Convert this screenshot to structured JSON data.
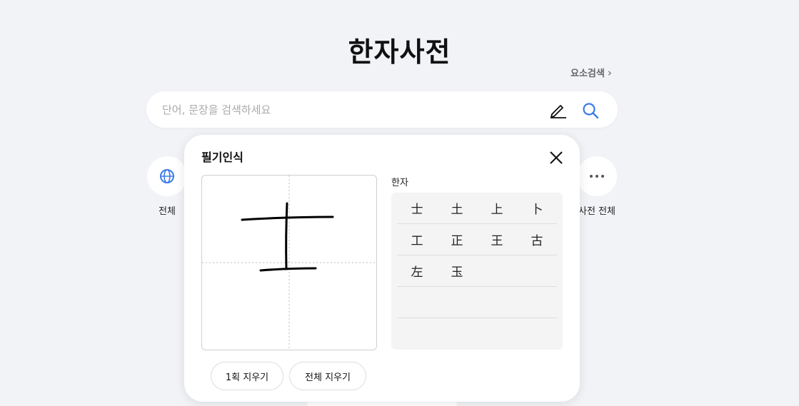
{
  "page": {
    "title": "한자사전"
  },
  "element_search": {
    "label": "요소검색",
    "chevron": "›"
  },
  "search": {
    "placeholder": "단어, 문장을 검색하세요",
    "value": ""
  },
  "categories": {
    "left": {
      "label": "전체",
      "icon": "globe-icon"
    },
    "right": {
      "label": "사전 전체",
      "icon": "more-icon"
    }
  },
  "popup": {
    "title": "필기인식",
    "results_label": "한자",
    "results": [
      [
        "士",
        "土",
        "上",
        "卜"
      ],
      [
        "工",
        "正",
        "王",
        "古"
      ],
      [
        "左",
        "玉",
        "",
        ""
      ],
      [
        "",
        "",
        "",
        ""
      ],
      [
        "",
        "",
        "",
        ""
      ]
    ],
    "undo_label": "1획 지우기",
    "clear_label": "전체 지우기"
  },
  "colors": {
    "accent": "#3d7be8",
    "background": "#f2f3f7"
  }
}
